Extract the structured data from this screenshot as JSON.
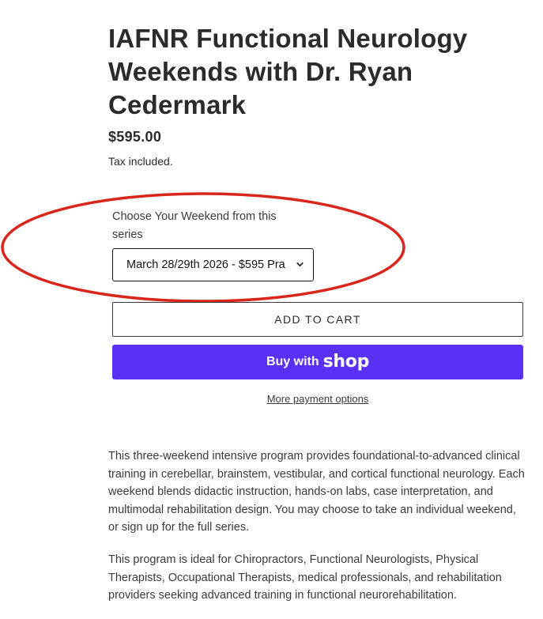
{
  "product": {
    "title": "IAFNR Functional Neurology Weekends with Dr. Ryan Cedermark",
    "price": "$595.00",
    "tax_note": "Tax included."
  },
  "variant": {
    "label": "Choose Your Weekend from this series",
    "selected": "March 28/29th 2026 - $595 Pra",
    "icon": "chevron-down-icon"
  },
  "actions": {
    "add_to_cart": "ADD TO CART",
    "buy_with": "Buy with",
    "shop_logo": "shop",
    "more_payment": "More payment options"
  },
  "description": {
    "paragraph_1": "This three-weekend intensive program provides foundational-to-advanced clinical training in cerebellar, brainstem, vestibular, and cortical functional neurology. Each weekend blends didactic instruction, hands-on labs, case interpretation, and multimodal rehabilitation design. You may choose to take an individual weekend, or sign up for the full series.",
    "paragraph_2": "This program is ideal for Chiropractors, Functional Neurologists, Physical Therapists, Occupational Therapists, medical professionals, and rehabilitation providers seeking advanced training in functional neurorehabilitation."
  },
  "colors": {
    "shop_button": "#5a31f4",
    "highlight_ellipse": "#d9261c"
  }
}
